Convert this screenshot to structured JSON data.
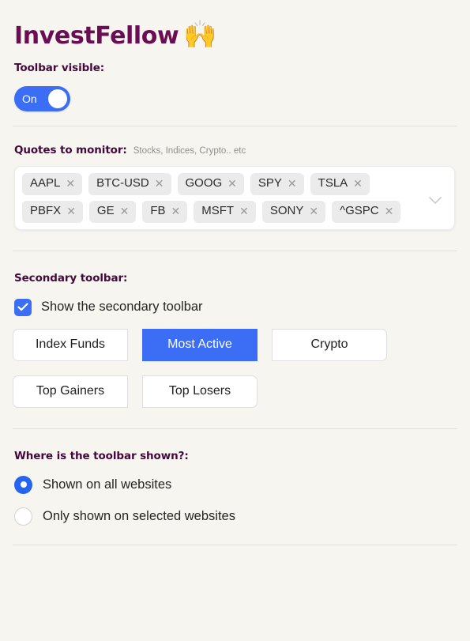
{
  "app": {
    "logo_text": "InvestFellow",
    "logo_emoji": "🙌"
  },
  "toolbar_visible": {
    "heading": "Toolbar visible:",
    "toggle_label": "On",
    "toggle_state": "on"
  },
  "quotes": {
    "heading": "Quotes to monitor:",
    "hint": "Stocks, Indices, Crypto.. etc",
    "remove_glyph": "✕",
    "tags": [
      {
        "label": "AAPL"
      },
      {
        "label": "BTC-USD"
      },
      {
        "label": "GOOG"
      },
      {
        "label": "SPY"
      },
      {
        "label": "TSLA"
      },
      {
        "label": "PBFX"
      },
      {
        "label": "GE"
      },
      {
        "label": "FB"
      },
      {
        "label": "MSFT"
      },
      {
        "label": "SONY"
      },
      {
        "label": "^GSPC"
      }
    ]
  },
  "secondary_toolbar": {
    "heading": "Secondary toolbar:",
    "checkbox_label": "Show the secondary toolbar",
    "checkbox_checked": true,
    "buttons_row1": [
      {
        "label": "Index Funds",
        "active": false
      },
      {
        "label": "Most Active",
        "active": true
      },
      {
        "label": "Crypto",
        "active": false
      }
    ],
    "buttons_row2": [
      {
        "label": "Top Gainers",
        "active": false
      },
      {
        "label": "Top Losers",
        "active": false
      }
    ]
  },
  "where_shown": {
    "heading": "Where is the toolbar shown?:",
    "options": [
      {
        "label": "Shown on all websites",
        "selected": true
      },
      {
        "label": "Only shown on selected websites",
        "selected": false
      }
    ]
  },
  "colors": {
    "background": "#f6f5f0",
    "accent_blue": "#3b6ef5",
    "heading_purple": "#43093b",
    "logo_purple": "#6b0d52",
    "tag_bg": "#ebebeb",
    "divider": "#e2e0da"
  }
}
